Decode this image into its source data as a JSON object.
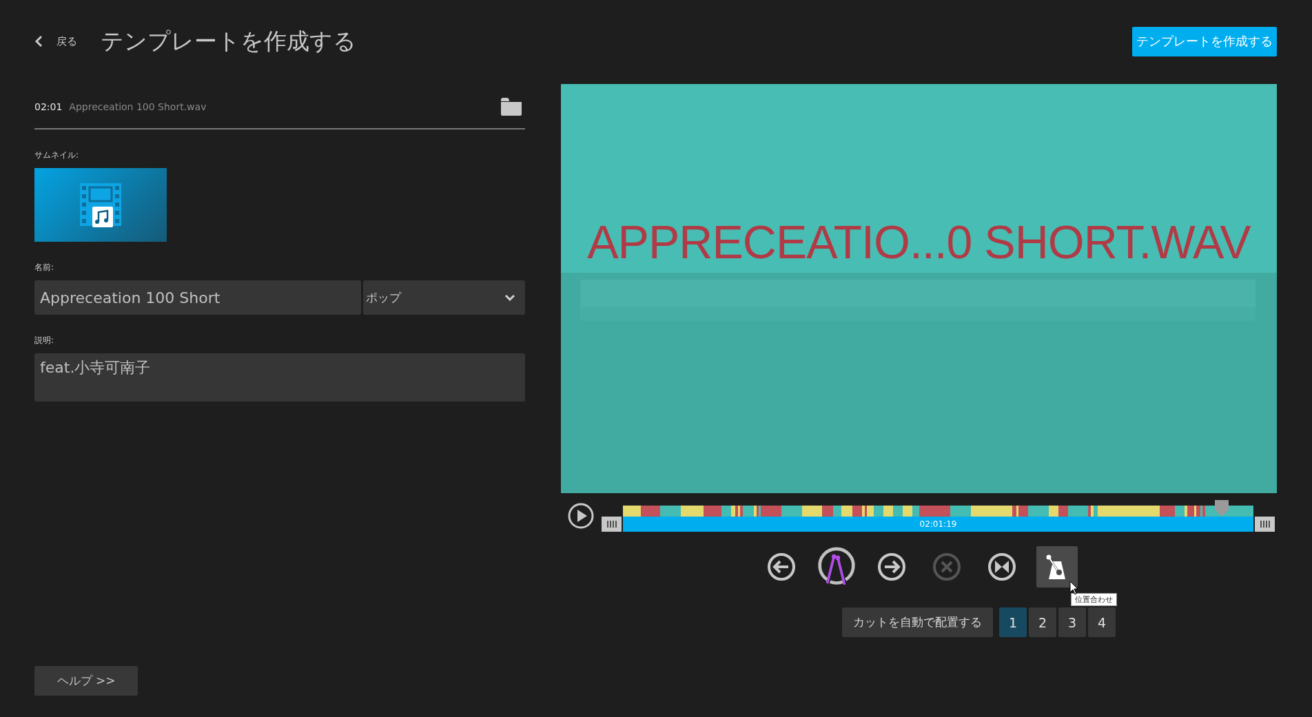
{
  "header": {
    "back_label": "戻る",
    "title": "テンプレートを作成する",
    "create_button": "テンプレートを作成する"
  },
  "file": {
    "duration": "02:01",
    "name": "Appreceation 100 Short.wav"
  },
  "thumbnail": {
    "label": "サムネイル:"
  },
  "name_field": {
    "label": "名前:",
    "value": "Appreceation 100 Short"
  },
  "genre_select": {
    "value": "ポップ"
  },
  "description_field": {
    "label": "説明:",
    "value": "feat.小寺可南子"
  },
  "help_button": "ヘルプ >>",
  "preview": {
    "title_text": "APPRECEATIO...0 SHORT.WAV"
  },
  "timeline": {
    "time": "02:01:19",
    "level": 0.95
  },
  "tools": [
    {
      "kind": "prev",
      "disabled": false,
      "selected": false
    },
    {
      "kind": "drum",
      "disabled": false,
      "selected": false
    },
    {
      "kind": "next",
      "disabled": false,
      "selected": false
    },
    {
      "kind": "delete",
      "disabled": true,
      "selected": false
    },
    {
      "kind": "split",
      "disabled": false,
      "selected": false
    },
    {
      "kind": "metronome",
      "disabled": false,
      "selected": true,
      "tooltip": "位置合わせ"
    }
  ],
  "auto_place_button": "カットを自動で配置する",
  "pages": [
    {
      "label": "1",
      "selected": true
    },
    {
      "label": "2",
      "selected": false
    },
    {
      "label": "3",
      "selected": false
    },
    {
      "label": "4",
      "selected": false
    }
  ]
}
